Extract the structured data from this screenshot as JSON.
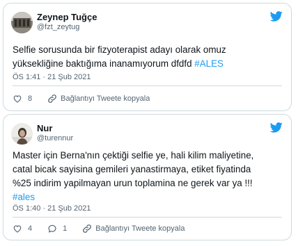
{
  "tweets": [
    {
      "author": {
        "name": "Zeynep Tuğçe",
        "handle": "@fzt_zeytug"
      },
      "text_lines": [
        "Selfie sorusunda bir fizyoterapist adayı olarak omuz",
        "yüksekliğine baktığıma inanamıyorum dfdfd "
      ],
      "hashtag": "#ALES",
      "timestamp": "ÖS 1:41 · 21 Şub 2021",
      "actions": {
        "likes": "8",
        "copy_link": "Bağlantıyı Tweete kopyala"
      },
      "icons": {
        "avatar": "profile-photo",
        "logo": "twitter-bird-icon",
        "like": "heart-icon",
        "link": "link-icon"
      }
    },
    {
      "author": {
        "name": "Nur",
        "handle": "@turennur"
      },
      "text_lines": [
        "Master için Berna'nın çektiği selfie ye, hali kilim maliyetine,",
        "catal bicak sayisina gemileri yanastirmaya, etiket fiyatinda",
        "%25 indirim yapilmayan urun toplamina ne gerek var ya !!!"
      ],
      "hashtag": "#ales",
      "timestamp": "ÖS 1:40 · 21 Şub 2021",
      "actions": {
        "likes": "4",
        "replies": "1",
        "copy_link": "Bağlantıyı Tweete kopyala"
      },
      "icons": {
        "avatar": "profile-photo",
        "logo": "twitter-bird-icon",
        "like": "heart-icon",
        "reply": "reply-icon",
        "link": "link-icon"
      }
    }
  ],
  "colors": {
    "accent": "#1d9bf0",
    "text": "#0f1419",
    "muted": "#536471",
    "border": "#cfd9de"
  }
}
